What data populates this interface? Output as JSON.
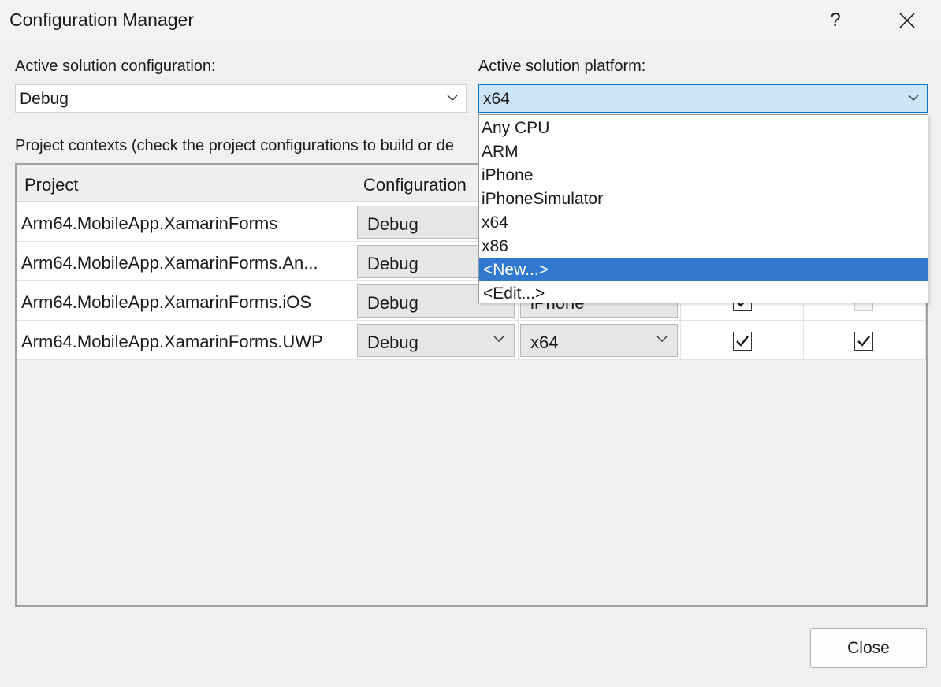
{
  "window": {
    "title": "Configuration Manager",
    "help_label": "?"
  },
  "active_config": {
    "label": "Active solution configuration:",
    "value": "Debug"
  },
  "active_platform": {
    "label": "Active solution platform:",
    "value": "x64",
    "options": [
      "Any CPU",
      "ARM",
      "iPhone",
      "iPhoneSimulator",
      "x64",
      "x86",
      "<New...>",
      "<Edit...>"
    ],
    "highlighted": "<New...>"
  },
  "project_contexts_label": "Project contexts (check the project configurations to build or de",
  "grid": {
    "headers": {
      "project": "Project",
      "configuration": "Configuration"
    },
    "rows": [
      {
        "project": "Arm64.MobileApp.XamarinForms",
        "configuration": "Debug",
        "platform": "",
        "build": null,
        "deploy": null
      },
      {
        "project": "Arm64.MobileApp.XamarinForms.An...",
        "configuration": "Debug",
        "platform": "",
        "build": null,
        "deploy": null
      },
      {
        "project": "Arm64.MobileApp.XamarinForms.iOS",
        "configuration": "Debug",
        "platform": "iPhone",
        "build": true,
        "deploy": false
      },
      {
        "project": "Arm64.MobileApp.XamarinForms.UWP",
        "configuration": "Debug",
        "platform": "x64",
        "build": true,
        "deploy": true
      }
    ]
  },
  "buttons": {
    "close": "Close"
  },
  "colors": {
    "accent": "#0078d4",
    "selection": "#3078d0",
    "open_combo": "#cce4f7"
  }
}
